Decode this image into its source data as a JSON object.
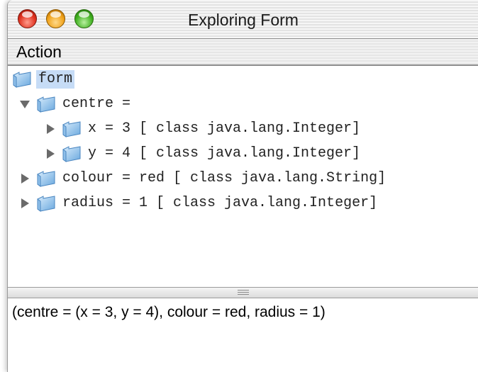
{
  "window": {
    "title": "Exploring Form"
  },
  "menubar": {
    "items": [
      "Action"
    ]
  },
  "tree": {
    "nodes": [
      {
        "label": "form",
        "disclosure": "none",
        "selected": true,
        "depth": 0
      },
      {
        "label": "centre =",
        "disclosure": "expanded",
        "selected": false,
        "depth": 1
      },
      {
        "label": "x = 3 [ class java.lang.Integer]",
        "disclosure": "collapsed",
        "selected": false,
        "depth": 2
      },
      {
        "label": "y = 4 [ class java.lang.Integer]",
        "disclosure": "collapsed",
        "selected": false,
        "depth": 2
      },
      {
        "label": "colour = red [ class java.lang.String]",
        "disclosure": "collapsed",
        "selected": false,
        "depth": 1
      },
      {
        "label": "radius = 1 [ class java.lang.Integer]",
        "disclosure": "collapsed",
        "selected": false,
        "depth": 1
      }
    ]
  },
  "output": {
    "text": "(centre = (x = 3, y = 4), colour = red, radius = 1)"
  },
  "icons": {
    "folder": "folder-icon",
    "expanded": "disclosure-triangle-down-icon",
    "collapsed": "disclosure-triangle-right-icon"
  },
  "colors": {
    "selection": "#c6dcf6",
    "folder_light": "#cfe6fb",
    "folder_dark": "#5d9fd8"
  }
}
